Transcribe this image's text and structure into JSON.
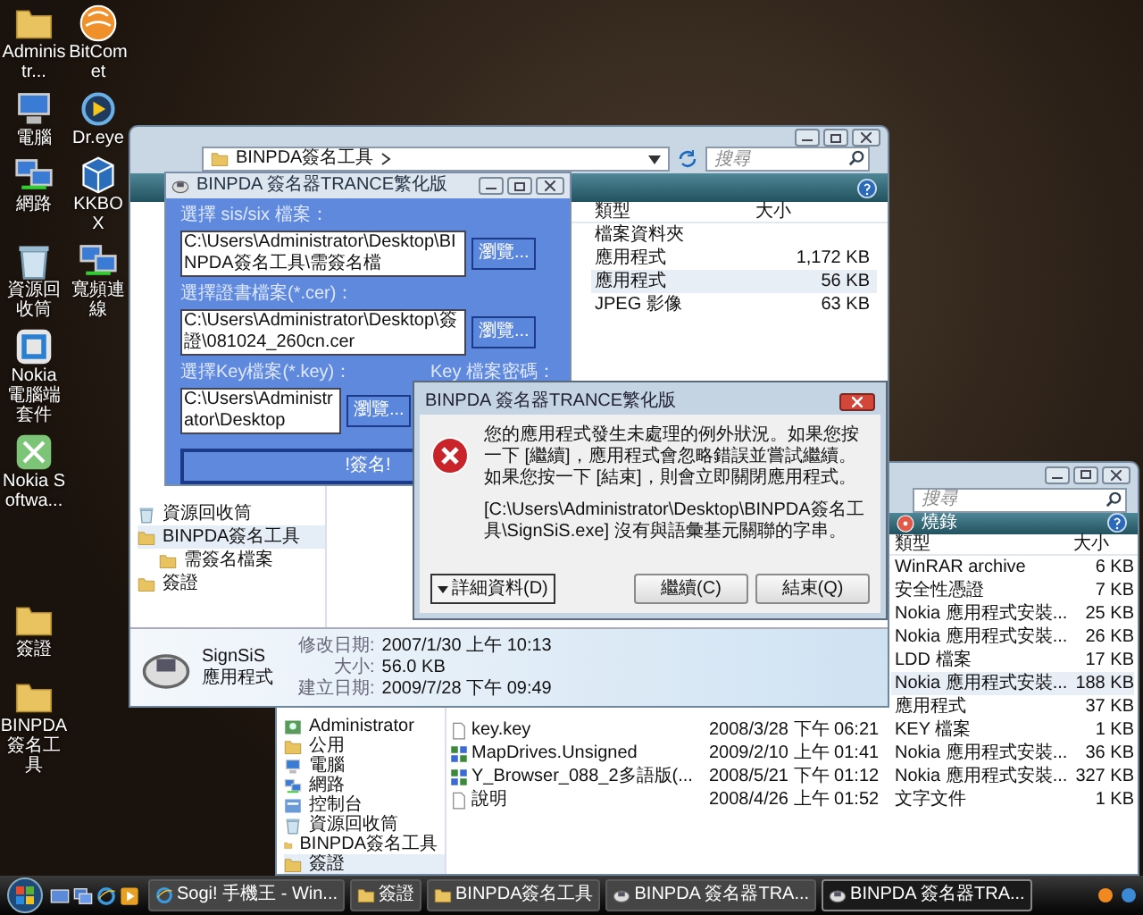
{
  "desktop_icon_rows": [
    [
      {
        "label": "Administr...",
        "kind": "folder"
      },
      {
        "label": "BitComet",
        "kind": "orb"
      }
    ],
    [
      {
        "label": "電腦",
        "kind": "computer"
      },
      {
        "label": "Dr.eye",
        "kind": "eye"
      }
    ],
    [
      {
        "label": "網路",
        "kind": "network"
      },
      {
        "label": "KKBOX",
        "kind": "cube"
      }
    ],
    [
      {
        "label": "資源回收筒",
        "kind": "recycle"
      },
      {
        "label": "寬頻連線",
        "kind": "network"
      }
    ],
    [
      {
        "label": "Nokia 電腦端套件",
        "kind": "nokia"
      }
    ],
    [
      {
        "label": "Nokia Softwa...",
        "kind": "updater"
      }
    ]
  ],
  "desktop_icons_lower": [
    {
      "label": "簽證",
      "kind": "folder"
    },
    {
      "label": "BINPDA簽名工具",
      "kind": "folder"
    }
  ],
  "explorer_back": {
    "search": {
      "placeholder": "搜尋"
    },
    "toolbar": [
      {
        "label": "燒錄"
      }
    ],
    "nav_items": [
      {
        "label": "Administrator",
        "kind": "user",
        "selected": false
      },
      {
        "label": "公用",
        "kind": "folder",
        "selected": false
      },
      {
        "label": "電腦",
        "kind": "computer",
        "selected": false
      },
      {
        "label": "網路",
        "kind": "network",
        "selected": false
      },
      {
        "label": "控制台",
        "kind": "control",
        "selected": false
      },
      {
        "label": "資源回收筒",
        "kind": "recycle",
        "selected": false
      },
      {
        "label": "BINPDA簽名工具",
        "kind": "folder",
        "selected": false
      },
      {
        "label": "簽證",
        "kind": "folder",
        "selected": true
      }
    ],
    "columns": [
      "類型",
      "大小"
    ],
    "rows": [
      {
        "type": "WinRAR archive",
        "size": "6 KB",
        "selected": false
      },
      {
        "type": "安全性憑證",
        "size": "7 KB",
        "selected": false
      },
      {
        "type": "Nokia 應用程式安裝...",
        "size": "25 KB",
        "selected": false
      },
      {
        "type": "Nokia 應用程式安裝...",
        "size": "26 KB",
        "selected": false
      },
      {
        "type": "LDD 檔案",
        "size": "17 KB",
        "selected": false
      },
      {
        "type": "Nokia 應用程式安裝...",
        "size": "188 KB",
        "selected": true
      },
      {
        "type": "應用程式",
        "size": "37 KB",
        "selected": false
      },
      {
        "name": "key.key",
        "kind": "file",
        "modified": "2008/3/28 下午 06:21",
        "type": "KEY 檔案",
        "size": "1 KB",
        "selected": false
      },
      {
        "name": "MapDrives.Unsigned",
        "kind": "package",
        "modified": "2009/2/10 上午 01:41",
        "type": "Nokia 應用程式安裝...",
        "size": "36 KB",
        "selected": false
      },
      {
        "name": "Y_Browser_088_2多語版(...",
        "kind": "package",
        "modified": "2008/5/21 下午 01:12",
        "type": "Nokia 應用程式安裝...",
        "size": "327 KB",
        "selected": false
      },
      {
        "name": "說明",
        "kind": "file",
        "modified": "2008/4/26 上午 01:52",
        "type": "文字文件",
        "size": "1 KB",
        "selected": false
      }
    ]
  },
  "explorer_front": {
    "address": "BINPDA簽名工具",
    "search": {
      "placeholder": "搜尋"
    },
    "nav_items": [
      {
        "label": "資源回收筒",
        "kind": "recycle",
        "selected": false
      },
      {
        "label": "BINPDA簽名工具",
        "kind": "folder",
        "selected": true,
        "children": [
          {
            "label": "需簽名檔案",
            "kind": "folder",
            "selected": false
          }
        ]
      },
      {
        "label": "簽證",
        "kind": "folder",
        "selected": false
      }
    ],
    "columns": [
      "類型",
      "大小"
    ],
    "rows": [
      {
        "type": "檔案資料夾",
        "selected": false
      },
      {
        "type": "應用程式",
        "size": "1,172 KB",
        "selected": false
      },
      {
        "type": "應用程式",
        "size": "56 KB",
        "selected": true
      },
      {
        "type": "JPEG 影像",
        "size": "63 KB",
        "selected": false
      }
    ],
    "details": {
      "name": "SignSiS",
      "type": "應用程式",
      "fields": [
        {
          "label": "修改日期:",
          "value": "2007/1/30 上午 10:13"
        },
        {
          "label": "大小:",
          "value": "56.0 KB"
        },
        {
          "label": "建立日期:",
          "value": "2009/7/28 下午 09:49"
        }
      ]
    }
  },
  "tool_window": {
    "title": "BINPDA 簽名器TRANCE繁化版",
    "file_rows": [
      {
        "label": "選擇 sis/six 檔案：",
        "path": "C:\\Users\\Administrator\\Desktop\\BINPDA簽名工具\\需簽名檔",
        "button": "瀏覽..."
      },
      {
        "label": "選擇證書檔案(*.cer)：",
        "path": "C:\\Users\\Administrator\\Desktop\\簽證\\081024_260cn.cer",
        "button": "瀏覽..."
      },
      {
        "label": "選擇Key檔案(*.key)：",
        "path": "C:\\Users\\Administrator\\Desktop",
        "button": "瀏覽...",
        "password_label": "Key 檔案密碼："
      }
    ],
    "sign_button": "!簽名!"
  },
  "error_dialog": {
    "title": "BINPDA 簽名器TRANCE繁化版",
    "paragraphs": [
      "您的應用程式發生未處理的例外狀況。如果您按一下 [繼續]，應用程式會忽略錯誤並嘗試繼續。如果您按一下 [結束]，則會立即關閉應用程式。",
      "[C:\\Users\\Administrator\\Desktop\\BINPDA簽名工具\\SignSiS.exe] 沒有與語彙基元關聯的字串。"
    ],
    "buttons": [
      {
        "label": "詳細資料(D)",
        "kind": "details"
      },
      {
        "label": "繼續(C)",
        "kind": "action"
      },
      {
        "label": "結束(Q)",
        "kind": "action"
      }
    ]
  },
  "taskbar": {
    "quick_launch": [
      {
        "kind": "desktop"
      },
      {
        "kind": "switch"
      },
      {
        "kind": "browser"
      },
      {
        "kind": "media"
      }
    ],
    "tasks": [
      {
        "label": "Sogi! 手機王 - Win...",
        "kind": "browser",
        "selected": false
      },
      {
        "label": "簽證",
        "kind": "folder",
        "selected": false
      },
      {
        "label": "BINPDA簽名工具",
        "kind": "folder",
        "selected": false
      },
      {
        "label": "BINPDA 簽名器TRA...",
        "kind": "app",
        "selected": false
      },
      {
        "label": "BINPDA 簽名器TRA...",
        "kind": "app",
        "selected": true
      }
    ]
  }
}
